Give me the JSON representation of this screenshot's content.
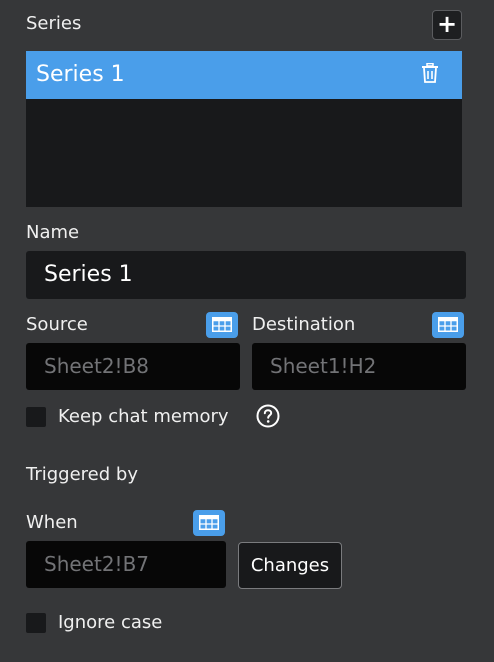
{
  "series_section": {
    "title": "Series",
    "add_glyph": "+",
    "items": [
      {
        "label": "Series 1",
        "selected": true
      }
    ]
  },
  "name_field": {
    "label": "Name",
    "value": "Series 1"
  },
  "source_field": {
    "label": "Source",
    "placeholder": "Sheet2!B8"
  },
  "destination_field": {
    "label": "Destination",
    "placeholder": "Sheet1!H2"
  },
  "keep_chat_memory": {
    "label": "Keep chat memory",
    "checked": false
  },
  "triggered_by": {
    "heading": "Triggered by",
    "when_label": "When",
    "when_placeholder": "Sheet2!B7",
    "changes_button": "Changes"
  },
  "ignore_case": {
    "label": "Ignore case",
    "checked": false
  },
  "colors": {
    "background": "#363739",
    "accent": "#4a9eea",
    "input_bg": "#070707",
    "panel_bg": "#18191b"
  },
  "icons": {
    "add": "plus-icon",
    "delete": "trash-icon",
    "range_picker": "table-grid-icon",
    "help": "question-circle-icon"
  }
}
